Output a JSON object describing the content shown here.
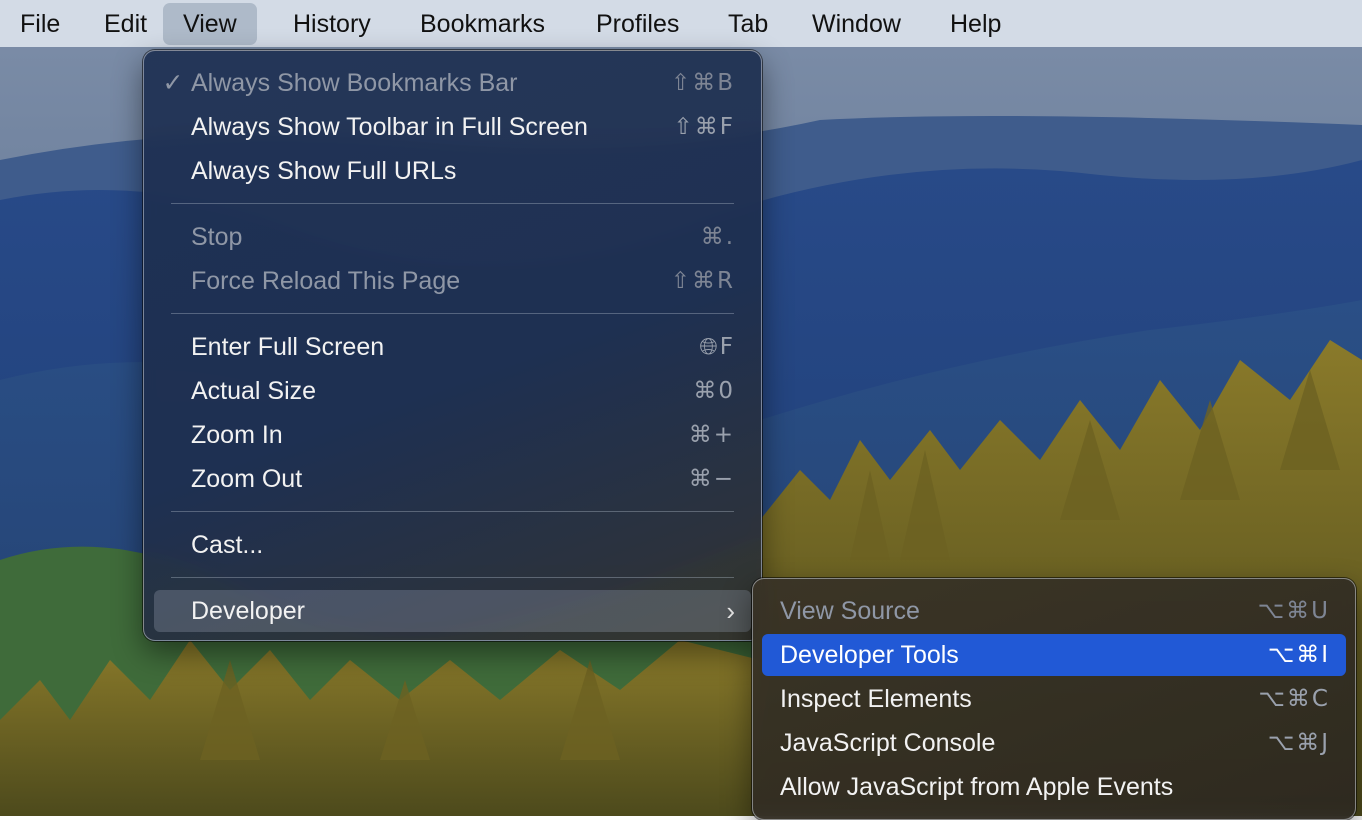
{
  "menubar": {
    "items": [
      "File",
      "Edit",
      "View",
      "History",
      "Bookmarks",
      "Profiles",
      "Tab",
      "Window",
      "Help"
    ],
    "active": "View"
  },
  "view_menu": {
    "items": [
      {
        "label": "Always Show Bookmarks Bar",
        "shortcut": "⇧⌘B",
        "checked": true,
        "enabled": false
      },
      {
        "label": "Always Show Toolbar in Full Screen",
        "shortcut": "⇧⌘F",
        "enabled": true
      },
      {
        "label": "Always Show Full URLs",
        "shortcut": "",
        "enabled": true
      },
      {
        "label": "Stop",
        "shortcut": "⌘.",
        "enabled": false
      },
      {
        "label": "Force Reload This Page",
        "shortcut": "⇧⌘R",
        "enabled": false
      },
      {
        "label": "Enter Full Screen",
        "shortcut": "🌐︎F",
        "enabled": true
      },
      {
        "label": "Actual Size",
        "shortcut": "⌘0",
        "enabled": true
      },
      {
        "label": "Zoom In",
        "shortcut": "⌘+",
        "enabled": true
      },
      {
        "label": "Zoom Out",
        "shortcut": "⌘−",
        "enabled": true
      },
      {
        "label": "Cast...",
        "shortcut": "",
        "enabled": true
      },
      {
        "label": "Developer",
        "shortcut": "",
        "enabled": true,
        "submenu_open": true
      }
    ],
    "check_mark": "✓",
    "submenu_arrow": "›"
  },
  "developer_submenu": {
    "items": [
      {
        "label": "View Source",
        "shortcut": "⌥⌘U",
        "enabled": false
      },
      {
        "label": "Developer Tools",
        "shortcut": "⌥⌘I",
        "enabled": true,
        "highlighted": true
      },
      {
        "label": "Inspect Elements",
        "shortcut": "⌥⌘C",
        "enabled": true
      },
      {
        "label": "JavaScript Console",
        "shortcut": "⌥⌘J",
        "enabled": true
      },
      {
        "label": "Allow JavaScript from Apple Events",
        "shortcut": "",
        "enabled": true
      }
    ]
  },
  "colors": {
    "menubar_bg": "#d3dbe6",
    "menubar_active": "#aebac9",
    "highlight": "#2159d6"
  }
}
